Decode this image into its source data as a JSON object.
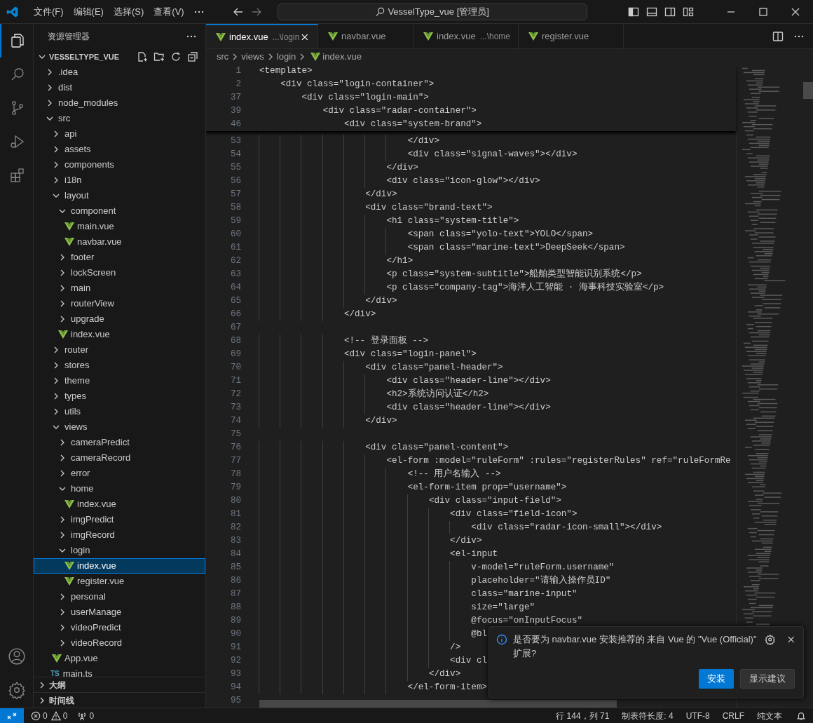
{
  "title_bar": {
    "menus": [
      "文件(F)",
      "编辑(E)",
      "选择(S)",
      "查看(V)"
    ],
    "search": "VesselType_vue [管理员]"
  },
  "activity_bar": {
    "items": [
      {
        "kind": "explorer",
        "selected": true
      },
      {
        "kind": "search",
        "selected": false
      },
      {
        "kind": "scm",
        "selected": false
      },
      {
        "kind": "debug",
        "selected": false
      },
      {
        "kind": "extensions",
        "selected": false
      }
    ]
  },
  "sidebar": {
    "title": "资源管理器",
    "root": {
      "label": "VESSELTYPE_VUE",
      "expanded": true
    },
    "tree": [
      {
        "label": ".idea",
        "kind": "folder",
        "expanded": false,
        "selected": false
      },
      {
        "label": "dist",
        "kind": "folder",
        "expanded": false,
        "selected": false
      },
      {
        "label": "node_modules",
        "kind": "folder",
        "expanded": false,
        "selected": false
      },
      {
        "label": "src",
        "kind": "folder",
        "expanded": true,
        "selected": false,
        "children": [
          {
            "label": "api",
            "kind": "folder",
            "expanded": false,
            "selected": false
          },
          {
            "label": "assets",
            "kind": "folder",
            "expanded": false,
            "selected": false
          },
          {
            "label": "components",
            "kind": "folder",
            "expanded": false,
            "selected": false
          },
          {
            "label": "i18n",
            "kind": "folder",
            "expanded": false,
            "selected": false
          },
          {
            "label": "layout",
            "kind": "folder",
            "expanded": true,
            "selected": false,
            "children": [
              {
                "label": "component",
                "kind": "folder",
                "expanded": true,
                "selected": false,
                "children": [
                  {
                    "label": "main.vue",
                    "kind": "vue",
                    "selected": false
                  },
                  {
                    "label": "navbar.vue",
                    "kind": "vue",
                    "selected": false
                  }
                ]
              },
              {
                "label": "footer",
                "kind": "folder",
                "expanded": false,
                "selected": false
              },
              {
                "label": "lockScreen",
                "kind": "folder",
                "expanded": false,
                "selected": false
              },
              {
                "label": "main",
                "kind": "folder",
                "expanded": false,
                "selected": false
              },
              {
                "label": "routerView",
                "kind": "folder",
                "expanded": false,
                "selected": false
              },
              {
                "label": "upgrade",
                "kind": "folder",
                "expanded": false,
                "selected": false
              },
              {
                "label": "index.vue",
                "kind": "vue",
                "selected": false
              }
            ]
          },
          {
            "label": "router",
            "kind": "folder",
            "expanded": false,
            "selected": false
          },
          {
            "label": "stores",
            "kind": "folder",
            "expanded": false,
            "selected": false
          },
          {
            "label": "theme",
            "kind": "folder",
            "expanded": false,
            "selected": false
          },
          {
            "label": "types",
            "kind": "folder",
            "expanded": false,
            "selected": false
          },
          {
            "label": "utils",
            "kind": "folder",
            "expanded": false,
            "selected": false
          },
          {
            "label": "views",
            "kind": "folder",
            "expanded": true,
            "selected": false,
            "children": [
              {
                "label": "cameraPredict",
                "kind": "folder",
                "expanded": false,
                "selected": false
              },
              {
                "label": "cameraRecord",
                "kind": "folder",
                "expanded": false,
                "selected": false
              },
              {
                "label": "error",
                "kind": "folder",
                "expanded": false,
                "selected": false
              },
              {
                "label": "home",
                "kind": "folder",
                "expanded": true,
                "selected": false,
                "children": [
                  {
                    "label": "index.vue",
                    "kind": "vue",
                    "selected": false
                  }
                ]
              },
              {
                "label": "imgPredict",
                "kind": "folder",
                "expanded": false,
                "selected": false
              },
              {
                "label": "imgRecord",
                "kind": "folder",
                "expanded": false,
                "selected": false
              },
              {
                "label": "login",
                "kind": "folder",
                "expanded": true,
                "selected": false,
                "children": [
                  {
                    "label": "index.vue",
                    "kind": "vue",
                    "selected": true
                  },
                  {
                    "label": "register.vue",
                    "kind": "vue",
                    "selected": false
                  }
                ]
              },
              {
                "label": "personal",
                "kind": "folder",
                "expanded": false,
                "selected": false
              },
              {
                "label": "userManage",
                "kind": "folder",
                "expanded": false,
                "selected": false
              },
              {
                "label": "videoPredict",
                "kind": "folder",
                "expanded": false,
                "selected": false
              },
              {
                "label": "videoRecord",
                "kind": "folder",
                "expanded": false,
                "selected": false
              }
            ]
          },
          {
            "label": "App.vue",
            "kind": "vue",
            "selected": false
          },
          {
            "label": "main.ts",
            "kind": "ts",
            "badge": "TS",
            "selected": false
          }
        ]
      }
    ],
    "panels": [
      {
        "label": "大纲",
        "expanded": false
      },
      {
        "label": "时间线",
        "expanded": false
      }
    ]
  },
  "editor": {
    "tabs": [
      {
        "label": "index.vue",
        "detail": "...\\login",
        "selected": true
      },
      {
        "label": "navbar.vue",
        "selected": false
      },
      {
        "label": "index.vue",
        "detail": "...\\home",
        "selected": false
      },
      {
        "label": "register.vue",
        "selected": false
      }
    ],
    "breadcrumb": [
      "src",
      "views",
      "login",
      "index.vue"
    ],
    "sticky_lines": [
      {
        "number": "1",
        "text": "<template>"
      },
      {
        "number": "2",
        "text": "    <div class=\"login-container\">"
      },
      {
        "number": "37",
        "text": "        <div class=\"login-main\">"
      },
      {
        "number": "39",
        "text": "            <div class=\"radar-container\">"
      },
      {
        "number": "46",
        "text": "                <div class=\"system-brand\">"
      }
    ],
    "lines": [
      {
        "number": "53",
        "text": "                            </div>"
      },
      {
        "number": "54",
        "text": "                            <div class=\"signal-waves\"></div>"
      },
      {
        "number": "55",
        "text": "                        </div>"
      },
      {
        "number": "56",
        "text": "                        <div class=\"icon-glow\"></div>"
      },
      {
        "number": "57",
        "text": "                    </div>"
      },
      {
        "number": "58",
        "text": "                    <div class=\"brand-text\">"
      },
      {
        "number": "59",
        "text": "                        <h1 class=\"system-title\">"
      },
      {
        "number": "60",
        "text": "                            <span class=\"yolo-text\">YOLO</span>"
      },
      {
        "number": "61",
        "text": "                            <span class=\"marine-text\">DeepSeek</span>"
      },
      {
        "number": "62",
        "text": "                        </h1>"
      },
      {
        "number": "63",
        "text": "                        <p class=\"system-subtitle\">船舶类型智能识别系统</p>"
      },
      {
        "number": "64",
        "text": "                        <p class=\"company-tag\">海洋人工智能 · 海事科技实验室</p>"
      },
      {
        "number": "65",
        "text": "                    </div>"
      },
      {
        "number": "66",
        "text": "                </div>"
      },
      {
        "number": "67"
      },
      {
        "number": "68",
        "text": "                <!-- 登录面板 -->"
      },
      {
        "number": "69",
        "text": "                <div class=\"login-panel\">"
      },
      {
        "number": "70",
        "text": "                    <div class=\"panel-header\">"
      },
      {
        "number": "71",
        "text": "                        <div class=\"header-line\"></div>"
      },
      {
        "number": "72",
        "text": "                        <h2>系统访问认证</h2>"
      },
      {
        "number": "73",
        "text": "                        <div class=\"header-line\"></div>"
      },
      {
        "number": "74",
        "text": "                    </div>"
      },
      {
        "number": "75"
      },
      {
        "number": "76",
        "text": "                    <div class=\"panel-content\">"
      },
      {
        "number": "77",
        "text": "                        <el-form :model=\"ruleForm\" :rules=\"registerRules\" ref=\"ruleFormRe"
      },
      {
        "number": "78",
        "text": "                            <!-- 用户名输入 -->"
      },
      {
        "number": "79",
        "text": "                            <el-form-item prop=\"username\">"
      },
      {
        "number": "80",
        "text": "                                <div class=\"input-field\">"
      },
      {
        "number": "81",
        "text": "                                    <div class=\"field-icon\">"
      },
      {
        "number": "82",
        "text": "                                        <div class=\"radar-icon-small\"></div>"
      },
      {
        "number": "83",
        "text": "                                    </div>"
      },
      {
        "number": "84",
        "text": "                                    <el-input"
      },
      {
        "number": "85",
        "text": "                                        v-model=\"ruleForm.username\""
      },
      {
        "number": "86",
        "text": "                                        placeholder=\"请输入操作员ID\""
      },
      {
        "number": "87",
        "text": "                                        class=\"marine-input\""
      },
      {
        "number": "88",
        "text": "                                        size=\"large\""
      },
      {
        "number": "89",
        "text": "                                        @focus=\"onInputFocus\""
      },
      {
        "number": "90",
        "text": "                                        @bl"
      },
      {
        "number": "91",
        "text": "                                    />"
      },
      {
        "number": "92",
        "text": "                                    <div cl"
      },
      {
        "number": "93",
        "text": "                                </div>"
      },
      {
        "number": "94",
        "text": "                            </el-form-item>"
      },
      {
        "number": "95"
      }
    ]
  },
  "notification": {
    "message": "是否要为 navbar.vue 安装推荐的 来自 Vue 的 \"Vue (Official)\" 扩展?",
    "buttons": [
      {
        "label": "安装",
        "kind": "primary"
      },
      {
        "label": "显示建议",
        "kind": "secondary"
      }
    ]
  },
  "status_bar": {
    "errors": "0",
    "warnings": "0",
    "ports": "0",
    "right": [
      "行 144，列 71",
      "制表符长度: 4",
      "UTF-8",
      "CRLF",
      "纯文本"
    ]
  }
}
